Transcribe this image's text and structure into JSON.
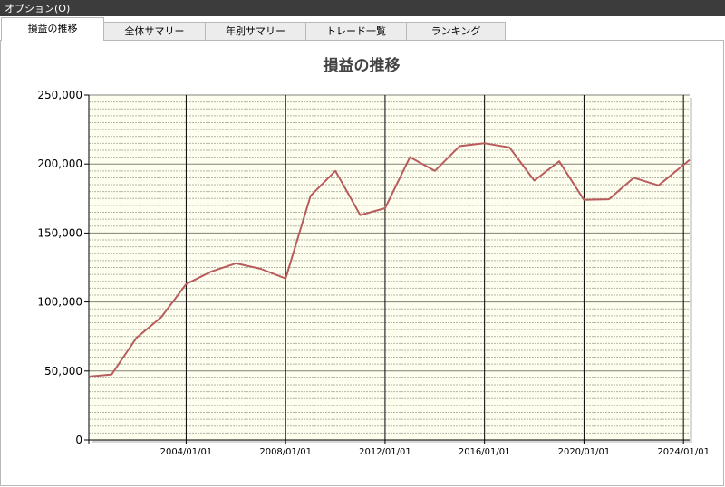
{
  "menubar": {
    "options_label": "オプション(O)"
  },
  "tabs": [
    {
      "label": "損益の推移",
      "active": true
    },
    {
      "label": "全体サマリー",
      "active": false
    },
    {
      "label": "年別サマリー",
      "active": false
    },
    {
      "label": "トレード一覧",
      "active": false
    },
    {
      "label": "ランキング",
      "active": false
    }
  ],
  "colors": {
    "plot_background": "#fffff0",
    "series_line": "#b85c5c",
    "menubar": "#3c3c3c"
  },
  "chart_data": {
    "type": "line",
    "title": "損益の推移",
    "xlabel": "",
    "ylabel": "",
    "ylim": [
      0,
      250000
    ],
    "y_ticks": [
      0,
      50000,
      100000,
      150000,
      200000,
      250000
    ],
    "y_tick_labels": [
      "0",
      "50,000",
      "100,000",
      "150,000",
      "200,000",
      "250,000"
    ],
    "x_ticks": [
      "2004-01-01",
      "2008-01-01",
      "2012-01-01",
      "2016-01-01",
      "2020-01-01",
      "2024-01-01"
    ],
    "x_tick_labels": [
      "2004/01/01",
      "2008/01/01",
      "2012/01/01",
      "2016/01/01",
      "2020/01/01",
      "2024/01/01"
    ],
    "xlim": [
      "2000-02-01",
      "2024-04-01"
    ],
    "grid": true,
    "legend": "none",
    "series": [
      {
        "x": [
          "2000-02-01",
          "2000-06-01",
          "2001-01-01",
          "2002-01-01",
          "2003-01-01",
          "2004-01-01",
          "2005-01-01",
          "2006-01-01",
          "2007-01-01",
          "2008-01-01",
          "2009-01-01",
          "2010-01-01",
          "2011-01-01",
          "2012-01-01",
          "2013-01-01",
          "2014-01-01",
          "2015-01-01",
          "2016-01-01",
          "2017-01-01",
          "2018-01-01",
          "2019-01-01",
          "2020-01-01",
          "2021-01-01",
          "2022-01-01",
          "2023-01-01",
          "2024-04-01"
        ],
        "values": [
          46000,
          46500,
          47500,
          74000,
          89000,
          113000,
          122000,
          128000,
          124000,
          117000,
          177000,
          195000,
          163000,
          168000,
          205000,
          195000,
          213000,
          215000,
          212000,
          188000,
          202000,
          174000,
          174500,
          190000,
          184500,
          203000
        ]
      }
    ]
  }
}
